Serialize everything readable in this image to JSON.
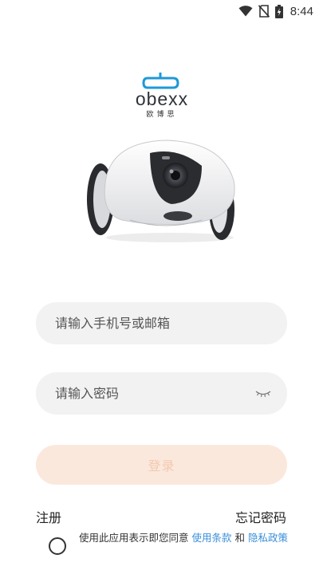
{
  "status_bar": {
    "time": "8:44",
    "icons": [
      "wifi-icon",
      "no-sim-icon",
      "battery-charging-icon"
    ]
  },
  "logo": {
    "wordmark": "obexx",
    "subtitle": "欧博思"
  },
  "login_form": {
    "account_placeholder": "请输入手机号或邮箱",
    "account_value": "",
    "password_placeholder": "请输入密码",
    "password_value": "",
    "login_label": "登录"
  },
  "links": {
    "register": "注册",
    "forgot_password": "忘记密码"
  },
  "agreement": {
    "prefix": "使用此应用表示即您同意 ",
    "terms": "使用条款",
    "conjunction": " 和 ",
    "privacy": "隐私政策",
    "checked": false
  },
  "colors": {
    "accent_link": "#3a8fd9",
    "login_button_bg": "#fbe8dc",
    "login_button_text": "#f2c9b1",
    "field_bg": "#f2f2f2",
    "logo_blue": "#1c9ad6"
  }
}
